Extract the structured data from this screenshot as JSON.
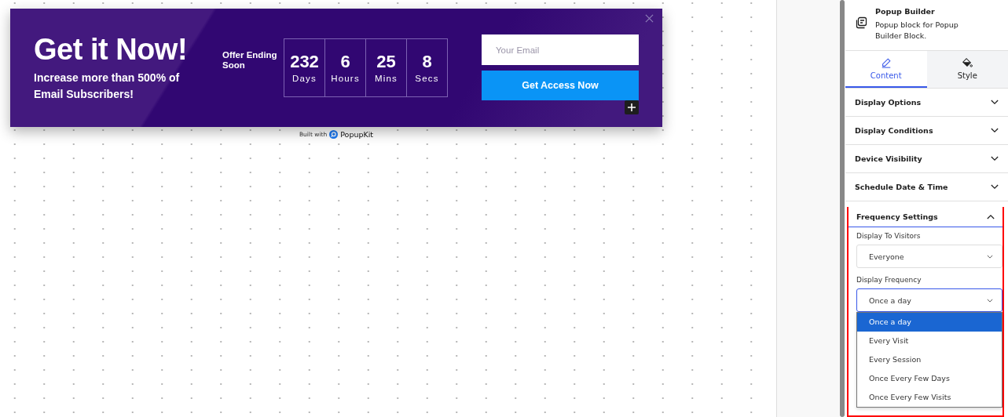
{
  "popup": {
    "title": "Get it Now!",
    "subtitle": "Increase more than 500% of Email Subscribers!",
    "countdown_label": "Offer Ending Soon",
    "countdown": [
      {
        "value": "232",
        "unit": "Days"
      },
      {
        "value": "6",
        "unit": "Hours"
      },
      {
        "value": "25",
        "unit": "Mins"
      },
      {
        "value": "8",
        "unit": "Secs"
      }
    ],
    "email": {
      "placeholder": "Your Email"
    },
    "submit": "Get Access Now"
  },
  "badge": {
    "prefix": "Built with",
    "brand": "PopupKit"
  },
  "sidebar": {
    "block": {
      "title": "Popup Builder",
      "description": "Popup block for Popup Builder Block."
    },
    "tabs": [
      {
        "label": "Content",
        "selected": true
      },
      {
        "label": "Style",
        "selected": false
      }
    ],
    "sections": [
      {
        "title": "Display Options",
        "expanded": false,
        "highlighted": false
      },
      {
        "title": "Display Conditions",
        "expanded": false,
        "highlighted": false
      },
      {
        "title": "Device Visibility",
        "expanded": false,
        "highlighted": false
      },
      {
        "title": "Schedule Date & Time",
        "expanded": false,
        "highlighted": false
      },
      {
        "title": "Frequency Settings",
        "expanded": true,
        "highlighted": true,
        "fields": [
          {
            "label": "Display To Visitors",
            "value": "Everyone",
            "open": false
          },
          {
            "label": "Display Frequency",
            "value": "Once a day",
            "open": true,
            "options": [
              {
                "label": "Once a day",
                "selected": true
              },
              {
                "label": "Every Visit",
                "selected": false
              },
              {
                "label": "Every Session",
                "selected": false
              },
              {
                "label": "Once Every Few Days",
                "selected": false
              },
              {
                "label": "Once Every Few Visits",
                "selected": false
              }
            ]
          }
        ]
      }
    ]
  }
}
